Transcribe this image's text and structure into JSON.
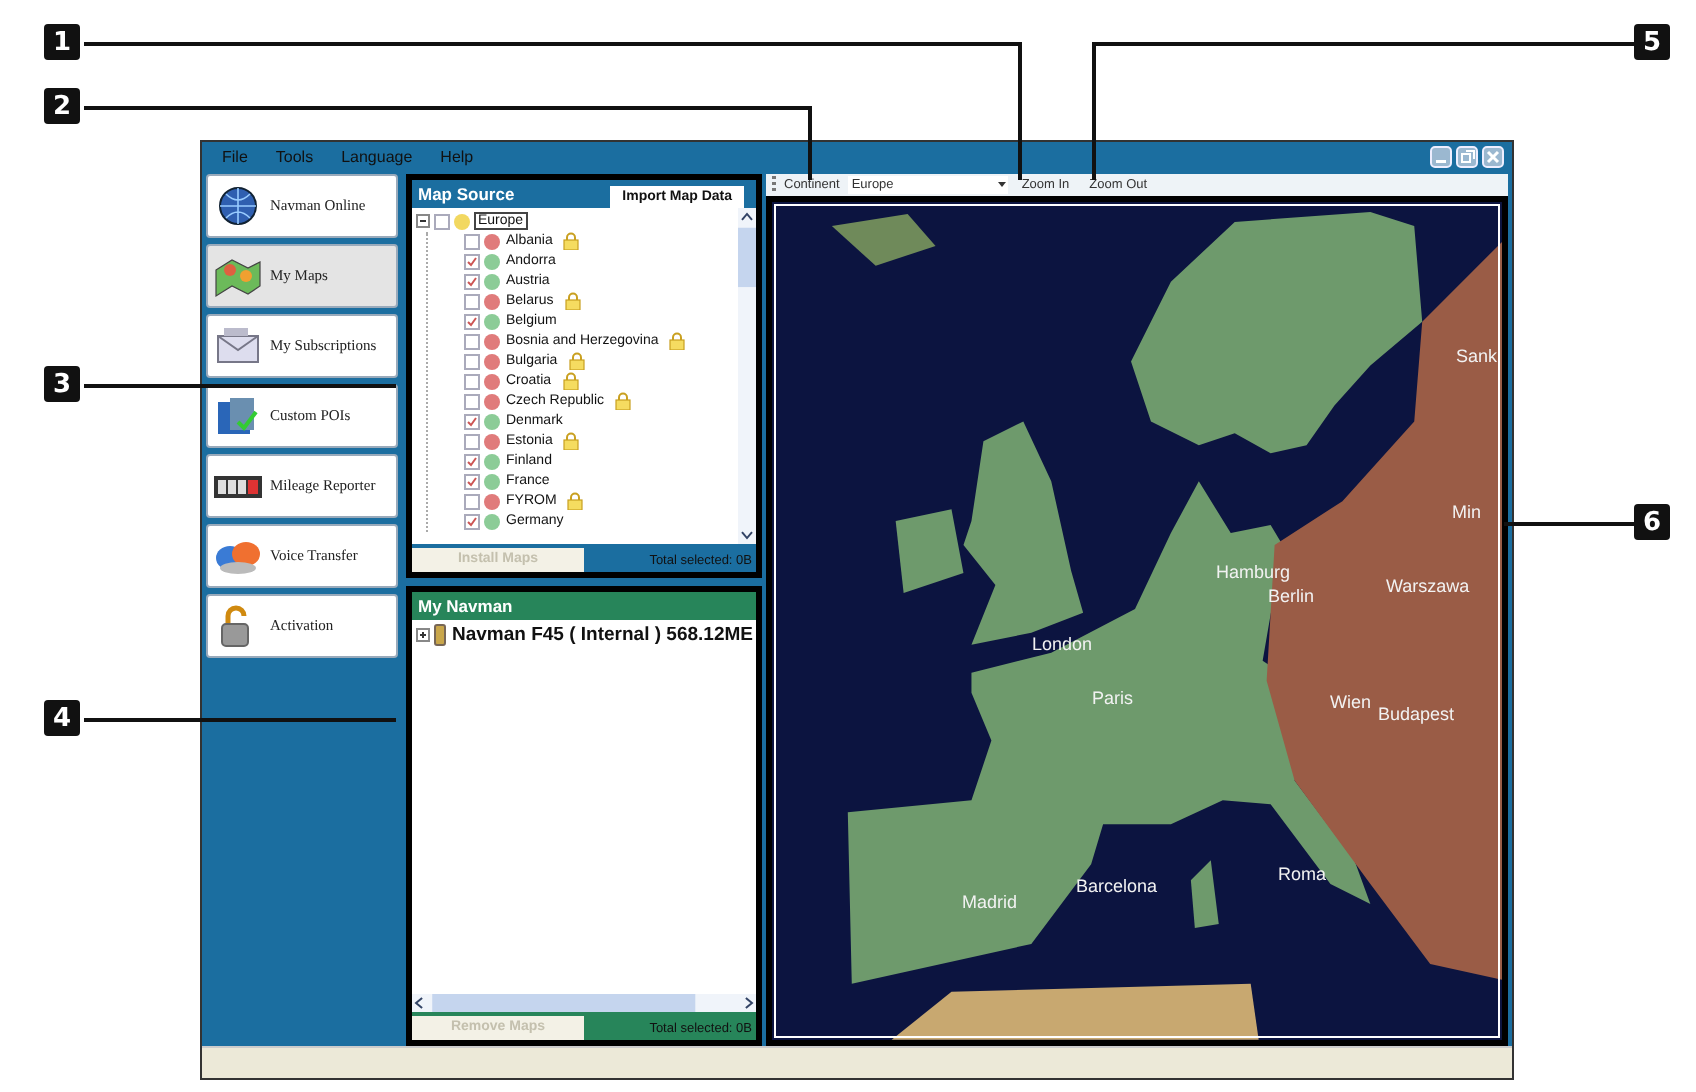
{
  "window": {
    "menu": [
      "File",
      "Tools",
      "Language",
      "Help"
    ]
  },
  "sidebar": {
    "items": [
      {
        "label": "Navman Online",
        "selected": false
      },
      {
        "label": "My Maps",
        "selected": true
      },
      {
        "label": "My Subscriptions",
        "selected": false
      },
      {
        "label": "Custom POIs",
        "selected": false
      },
      {
        "label": "Mileage Reporter",
        "selected": false
      },
      {
        "label": "Voice Transfer",
        "selected": false
      },
      {
        "label": "Activation",
        "selected": false
      }
    ]
  },
  "map_source": {
    "title": "Map Source",
    "tab": "Import Map Data",
    "tree": {
      "label": "Europe",
      "expanded": true,
      "checked": false,
      "children": [
        {
          "label": "Albania",
          "checked": false,
          "color": "#e07b7b",
          "locked": true
        },
        {
          "label": "Andorra",
          "checked": true,
          "color": "#8ccc97",
          "locked": false
        },
        {
          "label": "Austria",
          "checked": true,
          "color": "#8ccc97",
          "locked": false
        },
        {
          "label": "Belarus",
          "checked": false,
          "color": "#e07b7b",
          "locked": true
        },
        {
          "label": "Belgium",
          "checked": true,
          "color": "#8ccc97",
          "locked": false
        },
        {
          "label": "Bosnia and Herzegovina",
          "checked": false,
          "color": "#e07b7b",
          "locked": true
        },
        {
          "label": "Bulgaria",
          "checked": false,
          "color": "#e07b7b",
          "locked": true
        },
        {
          "label": "Croatia",
          "checked": false,
          "color": "#e07b7b",
          "locked": true
        },
        {
          "label": "Czech Republic",
          "checked": false,
          "color": "#e07b7b",
          "locked": true
        },
        {
          "label": "Denmark",
          "checked": true,
          "color": "#8ccc97",
          "locked": false
        },
        {
          "label": "Estonia",
          "checked": false,
          "color": "#e07b7b",
          "locked": true
        },
        {
          "label": "Finland",
          "checked": true,
          "color": "#8ccc97",
          "locked": false
        },
        {
          "label": "France",
          "checked": true,
          "color": "#8ccc97",
          "locked": false
        },
        {
          "label": "FYROM",
          "checked": false,
          "color": "#e07b7b",
          "locked": true
        },
        {
          "label": "Germany",
          "checked": true,
          "color": "#8ccc97",
          "locked": false
        }
      ]
    },
    "install_button": {
      "label": "Install Maps",
      "disabled": true
    },
    "total": "Total selected: 0B"
  },
  "my_navman": {
    "title": "My Navman",
    "tree": [
      {
        "label": "Navman F45 ( Internal ) 568.12ME",
        "expanded": false
      }
    ],
    "remove_button": {
      "label": "Remove Maps",
      "disabled": true
    },
    "total": "Total selected: 0B"
  },
  "map_toolbar": {
    "continent_label": "Continent",
    "continent": "Europe",
    "zoom_in": "Zoom In",
    "zoom_out": "Zoom Out"
  },
  "map": {
    "labels": [
      "Sank",
      "Min",
      "Hamburg",
      "Berlin",
      "Warszawa",
      "London",
      "Paris",
      "Wien",
      "Budapest",
      "Madrid",
      "Barcelona",
      "Roma"
    ]
  },
  "callouts": [
    "1",
    "2",
    "3",
    "4",
    "5",
    "6"
  ]
}
